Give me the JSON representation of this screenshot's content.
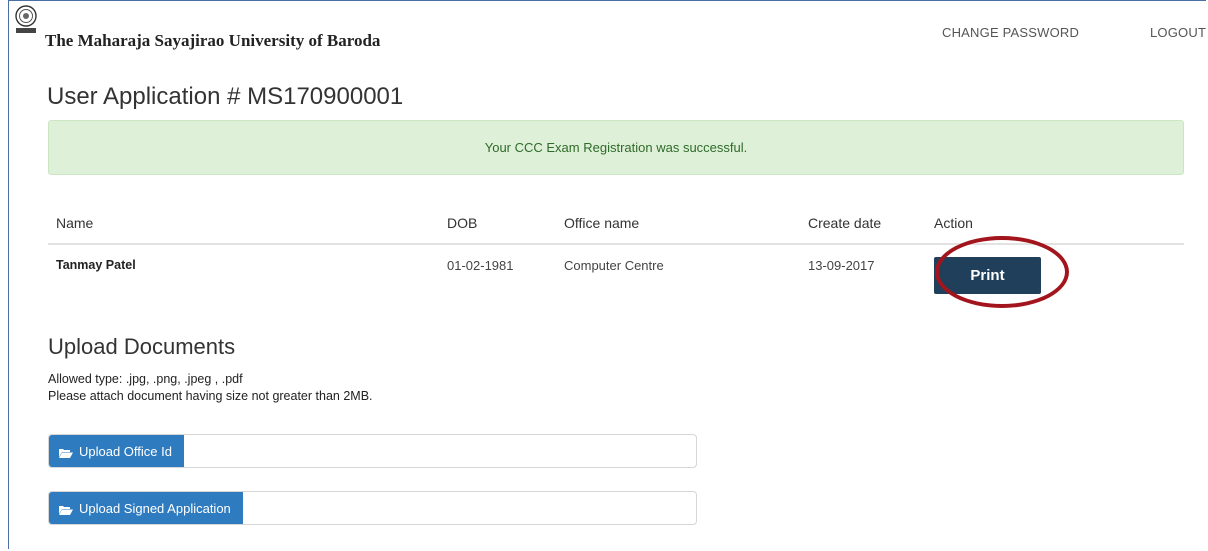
{
  "header": {
    "brand": "The Maharaja Sayajirao University of Baroda",
    "nav": {
      "change_password": "CHANGE PASSWORD",
      "logout": "LOGOUT"
    }
  },
  "page": {
    "title": "User Application # MS170900001",
    "alert": "Your CCC Exam Registration was successful."
  },
  "table": {
    "headers": [
      "Name",
      "DOB",
      "Office name",
      "Create date",
      "Action"
    ],
    "rows": [
      {
        "name": "Tanmay Patel",
        "dob": "01-02-1981",
        "office": "Computer Centre",
        "created": "13-09-2017",
        "action": "Print"
      }
    ]
  },
  "upload": {
    "title": "Upload Documents",
    "allowed": "Allowed type: .jpg, .png, .jpeg , .pdf",
    "size_note": "Please attach document having size not greater than 2MB.",
    "buttons": {
      "office_id": "Upload Office Id",
      "signed_application": "Upload Signed Application"
    }
  },
  "colors": {
    "accent": "#2f7bbf",
    "print_button": "#1f3f5b",
    "alert_bg": "#dff0d8",
    "highlight": "#a3151c"
  },
  "icons": {
    "logo": "university-seal-icon",
    "upload": "folder-open-icon"
  }
}
